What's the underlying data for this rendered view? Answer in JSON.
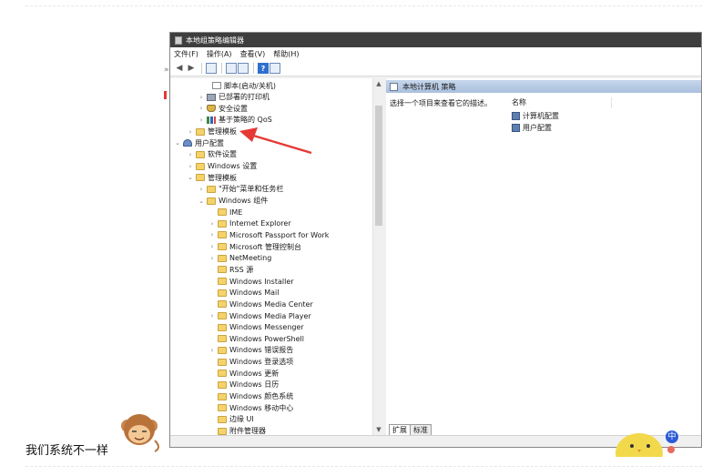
{
  "window": {
    "title": "本地组策略编辑器"
  },
  "menu": [
    {
      "label": "文件(F)"
    },
    {
      "label": "操作(A)"
    },
    {
      "label": "查看(V)"
    },
    {
      "label": "帮助(H)"
    }
  ],
  "toolbar": {
    "help_glyph": "?"
  },
  "tree": [
    {
      "label": "脚本(启动/关机)",
      "icon": "script-icon",
      "chevron": ""
    },
    {
      "label": "已部署的打印机",
      "icon": "printer-icon",
      "chevron": "›"
    },
    {
      "label": "安全设置",
      "icon": "shield-icon",
      "chevron": "›"
    },
    {
      "label": "基于策略的 QoS",
      "icon": "bar-chart-icon",
      "chevron": "›"
    },
    {
      "label": "管理模板",
      "icon": "folder-icon",
      "chevron": "›"
    },
    {
      "label": "用户配置",
      "icon": "user-config-icon",
      "chevron": "⌄"
    },
    {
      "label": "软件设置",
      "icon": "folder-icon",
      "chevron": "›"
    },
    {
      "label": "Windows 设置",
      "icon": "folder-icon",
      "chevron": "›"
    },
    {
      "label": "管理模板",
      "icon": "folder-icon",
      "chevron": "⌄"
    },
    {
      "label": "\"开始\"菜单和任务栏",
      "icon": "folder-icon",
      "chevron": "›"
    },
    {
      "label": "Windows 组件",
      "icon": "folder-icon",
      "chevron": "⌄"
    },
    {
      "label": "IME",
      "icon": "folder-icon",
      "chevron": ""
    },
    {
      "label": "Internet Explorer",
      "icon": "folder-icon",
      "chevron": "›"
    },
    {
      "label": "Microsoft Passport for Work",
      "icon": "folder-icon",
      "chevron": "›"
    },
    {
      "label": "Microsoft 管理控制台",
      "icon": "folder-icon",
      "chevron": "›"
    },
    {
      "label": "NetMeeting",
      "icon": "folder-icon",
      "chevron": "›"
    },
    {
      "label": "RSS 源",
      "icon": "folder-icon",
      "chevron": ""
    },
    {
      "label": "Windows Installer",
      "icon": "folder-icon",
      "chevron": ""
    },
    {
      "label": "Windows Mail",
      "icon": "folder-icon",
      "chevron": ""
    },
    {
      "label": "Windows Media Center",
      "icon": "folder-icon",
      "chevron": ""
    },
    {
      "label": "Windows Media Player",
      "icon": "folder-icon",
      "chevron": "›"
    },
    {
      "label": "Windows Messenger",
      "icon": "folder-icon",
      "chevron": ""
    },
    {
      "label": "Windows PowerShell",
      "icon": "folder-icon",
      "chevron": ""
    },
    {
      "label": "Windows 错误报告",
      "icon": "folder-icon",
      "chevron": "›"
    },
    {
      "label": "Windows 登录选项",
      "icon": "folder-icon",
      "chevron": ""
    },
    {
      "label": "Windows 更新",
      "icon": "folder-icon",
      "chevron": ""
    },
    {
      "label": "Windows 日历",
      "icon": "folder-icon",
      "chevron": ""
    },
    {
      "label": "Windows 颜色系统",
      "icon": "folder-icon",
      "chevron": ""
    },
    {
      "label": "Windows 移动中心",
      "icon": "folder-icon",
      "chevron": ""
    },
    {
      "label": "边缘 UI",
      "icon": "folder-icon",
      "chevron": ""
    },
    {
      "label": "附件管理器",
      "icon": "folder-icon",
      "chevron": ""
    }
  ],
  "pane": {
    "header": "本地计算机 策略",
    "description": "选择一个项目来查看它的描述。",
    "column_name": "名称",
    "entries": [
      {
        "label": "计算机配置"
      },
      {
        "label": "用户配置"
      }
    ]
  },
  "tabs": [
    {
      "label": "扩展"
    },
    {
      "label": "标准"
    }
  ],
  "caption": "我们系统不一样",
  "ime_indicator": "中",
  "annotation": {
    "arrow_color": "#e53935"
  }
}
